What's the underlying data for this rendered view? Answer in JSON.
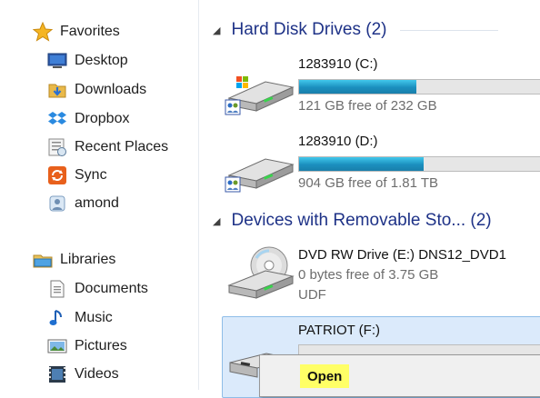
{
  "nav": {
    "favorites": [
      {
        "label": "Favorites",
        "icon": "star-icon"
      },
      {
        "label": "Desktop",
        "icon": "desktop-icon"
      },
      {
        "label": "Downloads",
        "icon": "downloads-icon"
      },
      {
        "label": "Dropbox",
        "icon": "dropbox-icon"
      },
      {
        "label": "Recent Places",
        "icon": "recent-places-icon"
      },
      {
        "label": "Sync",
        "icon": "sync-icon"
      },
      {
        "label": "amond",
        "icon": "user-icon"
      }
    ],
    "libraries": [
      {
        "label": "Libraries",
        "icon": "libraries-icon"
      },
      {
        "label": "Documents",
        "icon": "documents-icon"
      },
      {
        "label": "Music",
        "icon": "music-icon"
      },
      {
        "label": "Pictures",
        "icon": "pictures-icon"
      },
      {
        "label": "Videos",
        "icon": "videos-icon"
      }
    ]
  },
  "sections": {
    "hdd": "Hard Disk Drives (2)",
    "removable": "Devices with Removable Sto... (2)"
  },
  "drives": [
    {
      "name": "1283910 (C:)",
      "free": "121 GB free of 232 GB",
      "used_fraction": 0.48,
      "icon": "system-drive-icon"
    },
    {
      "name": "1283910 (D:)",
      "free": "904 GB free of 1.81 TB",
      "used_fraction": 0.51,
      "icon": "hard-drive-icon"
    }
  ],
  "removable": [
    {
      "name": "DVD RW Drive (E:) DNS12_DVD1",
      "free": "0 bytes free of 3.75 GB",
      "fs": "UDF",
      "icon": "dvd-drive-icon"
    },
    {
      "name": "PATRIOT (F:)",
      "icon": "usb-drive-icon"
    }
  ],
  "context_menu": {
    "open": "Open"
  },
  "colors": {
    "accent_title": "#1e3287",
    "bar_fill": "#26a0da",
    "highlight": "#ffff66",
    "selection": "#dbeafb"
  }
}
